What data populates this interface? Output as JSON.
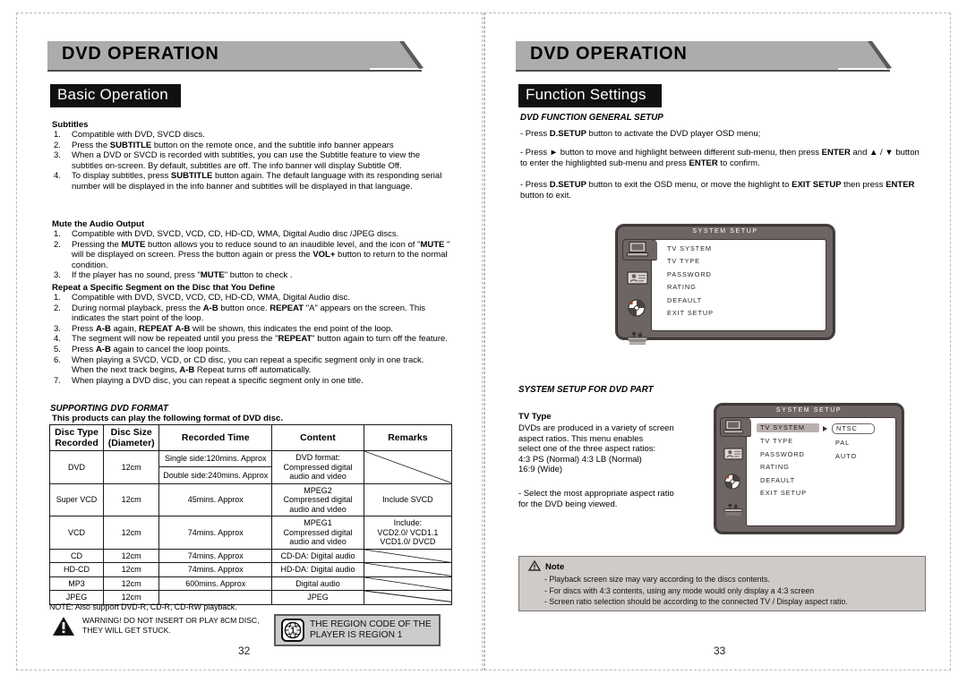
{
  "left_page": {
    "banner_title": "DVD OPERATION",
    "section_label": "Basic Operation",
    "page_number": "32",
    "subtitles": {
      "heading": "Subtitles",
      "items": [
        "Compatible with DVD, SVCD discs.",
        "Press the SUBTITLE button on the remote once, and the subtitle info banner appears",
        "When a DVD or SVCD is recorded with subtitles, you can use the Subtitle feature to view the subtitles on-screen. By default, subtitles are off. The info banner will display Subtitle Off.",
        "To display subtitles, press SUBTITLE button again. The default language with its responding serial number will be displayed in the info banner and subtitles will be displayed in that language."
      ]
    },
    "mute": {
      "heading": "Mute the Audio Output",
      "items": [
        "Compatible with DVD, SVCD, VCD, CD, HD-CD, WMA, Digital Audio disc /JPEG  discs.",
        "Pressing the MUTE button allows you to reduce sound to an inaudible level, and the icon of \"MUTE \" will be displayed on screen. Press the button again or press the VOL+ button to return to the normal condition.",
        "If the player has no sound, press \"MUTE\" button to check ."
      ]
    },
    "repeat": {
      "heading": "Repeat a Specific Segment on the Disc that You Define",
      "items": [
        "Compatible with DVD, SVCD, VCD, CD, HD-CD, WMA, Digital Audio disc.",
        "During normal playback, press the A-B button once. REPEAT \"A\" appears on the screen. This indicates the start point of the loop.",
        "Press A-B again, REPEAT A-B will be shown, this indicates the end point of the loop.",
        "The segment will now be repeated until you press the \"REPEAT\" button again to turn off the feature.",
        "Press A-B again to cancel the loop points.",
        "When playing a SVCD, VCD, or CD disc, you can repeat a specific segment only in one track. When the next track begins, A-B Repeat turns off automatically.",
        "When playing a DVD disc, you can repeat a specific segment only in one title."
      ]
    },
    "format_section": {
      "heading": "SUPPORTING DVD FORMAT",
      "subheading": "This products can play the following format of DVD disc.",
      "table": {
        "headers": [
          "Disc Type Recorded",
          "Disc Size (Diameter)",
          "Recorded Time",
          "Content",
          "Remarks"
        ],
        "header_lines": [
          [
            "Disc Type",
            "Recorded"
          ],
          [
            "Disc Size",
            "(Diameter)"
          ],
          [
            "Recorded Time"
          ],
          [
            "Content"
          ],
          [
            "Remarks"
          ]
        ],
        "rows": [
          {
            "type": "DVD",
            "size": "12cm",
            "time": [
              "Single side:120mins. Approx",
              "Double side:240mins. Approx"
            ],
            "content": [
              "DVD format:",
              "Compressed digital",
              "audio and video"
            ],
            "remarks": ""
          },
          {
            "type": "Super VCD",
            "size": "12cm",
            "time": [
              "45mins. Approx"
            ],
            "content": [
              "MPEG2",
              "Compressed digital",
              "audio and video"
            ],
            "remarks": "Include SVCD"
          },
          {
            "type": "VCD",
            "size": "12cm",
            "time": [
              "74mins. Approx"
            ],
            "content": [
              "MPEG1",
              "Compressed digital",
              "audio and video"
            ],
            "remarks": "Include: VCD2.0/ VCD1.1 VCD1.0/ DVCD"
          },
          {
            "type": "CD",
            "size": "12cm",
            "time": [
              "74mins. Approx"
            ],
            "content": [
              "CD-DA: Digital audio"
            ],
            "remarks": ""
          },
          {
            "type": "HD-CD",
            "size": "12cm",
            "time": [
              "74mins. Approx"
            ],
            "content": [
              "HD-DA: Digital audio"
            ],
            "remarks": ""
          },
          {
            "type": "MP3",
            "size": "12cm",
            "time": [
              "600mins. Approx"
            ],
            "content": [
              "Digital audio"
            ],
            "remarks": ""
          },
          {
            "type": "JPEG",
            "size": "12cm",
            "time": [
              ""
            ],
            "content": [
              "JPEG"
            ],
            "remarks": ""
          }
        ],
        "vcd_remarks_lines": [
          "Include:",
          "VCD2.0/ VCD1.1",
          "VCD1.0/ DVCD"
        ]
      },
      "note": "NOTE: Also support DVD-R, CD-R, CD-RW playback.",
      "warning": [
        "WARNING! DO NOT INSERT OR PLAY 8CM DISC,",
        "THEY WILL GET STUCK."
      ],
      "region": [
        "THE REGION CODE OF THE",
        "PLAYER IS REGION 1"
      ],
      "region_digit": "1"
    }
  },
  "right_page": {
    "banner_title": "DVD OPERATION",
    "section_label": "Function Settings",
    "page_number": "33",
    "general_setup": {
      "heading": "DVD FUNCTION GENERAL SETUP",
      "paragraphs": [
        "- Press  D.SETUP  button to activate the DVD player OSD menu;",
        "- Press ► button to move and highlight between different sub-menu, then press ENTER and ▲ / ▼ button to enter the highlighted sub-menu and press ENTER to confirm.",
        "- Press   D.SETUP   button to exit the OSD  menu, or move the highlight to EXIT SETUP then press ENTER button to  exit."
      ]
    },
    "osd_menu_1": {
      "title": "SYSTEM SETUP",
      "items": [
        "TV SYSTEM",
        "TV TYPE",
        "PASSWORD",
        "RATING",
        "DEFAULT",
        "EXIT SETUP"
      ],
      "selected": "",
      "icons": [
        "monitor-icon",
        "password-card-icon",
        "disc-rating-icon",
        "default-reset-icon"
      ]
    },
    "system_setup": {
      "heading": "SYSTEM SETUP FOR DVD PART",
      "tv_type_heading": "TV Type",
      "body_lines": [
        "DVDs are produced in a variety of screen",
        "aspect ratios. This menu enables",
        "select one of the three aspect  ratios:",
        "4:3 PS (Normal)      4:3 LB (Normal)",
        "16:9 (Wide)"
      ],
      "bullet_lines": [
        "- Select the most appropriate aspect ratio",
        "  for the DVD being viewed."
      ]
    },
    "osd_menu_2": {
      "title": "SYSTEM  SETUP",
      "items": [
        "TV SYSTEM",
        "TV TYPE",
        "PASSWORD",
        "RATING",
        "DEFAULT",
        "EXIT  SETUP"
      ],
      "selected": "TV SYSTEM",
      "submenu": [
        "NTSC",
        "PAL",
        "AUTO"
      ],
      "submenu_selected": "NTSC"
    },
    "note": {
      "label": "Note",
      "lines": [
        "- Playback screen size may vary according to the discs contents.",
        "- For discs with 4:3 contents, using any mode would only display a 4:3 screen",
        "- Screen ratio selection should be according to the connected TV / Display    aspect ratio."
      ]
    }
  },
  "colors": {
    "banner_gray": "#acacac",
    "banner_dark": "#4d4d4d",
    "label_black": "#111111",
    "osd_frame": "#6d6563",
    "osd_highlight": "#b9afac",
    "note_bg": "#cfcbc8",
    "region_bg": "#cccccc"
  }
}
